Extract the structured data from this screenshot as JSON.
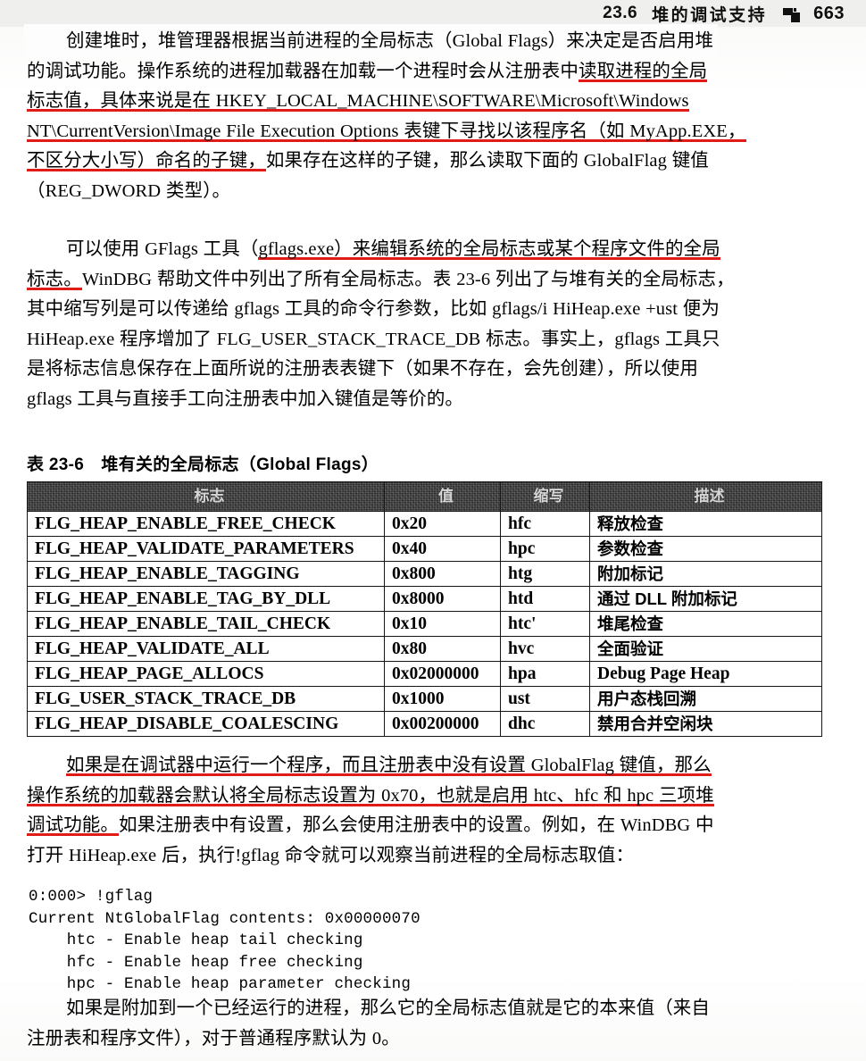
{
  "header": {
    "section_number": "23.6",
    "section_title": "堆的调试支持",
    "ornament": "black-block-ornament",
    "page_number": "663"
  },
  "paragraphs": {
    "p1": {
      "line1_highlighted": "创建堆时，堆管理器根据当前进程的全局标志（Global Flags）来决定是否启用堆",
      "line2_a": "的调试功能。操作系统的进程加载器在加载一个进程时会从注册表中",
      "line2_underlined": "读取进程的全局",
      "line3_underlined": "标志值，具体来说是在 HKEY_LOCAL_MACHINE\\SOFTWARE\\Microsoft\\Windows",
      "line4_underlined": "NT\\CurrentVersion\\Image File Execution Options 表键下寻找以该程序名（如 MyApp.EXE，",
      "line5_underlined": "不区分大小写）命名的子键，",
      "line5_rest": "如果存在这样的子键，那么读取下面的 GlobalFlag 键值",
      "line6": "（REG_DWORD 类型）。"
    },
    "p2": {
      "line1_a": "可以使用 GFlags 工具（",
      "line1_underlined": "gflags.exe）来编辑系统的全局标志或某个程序文件的全局",
      "line2_underlined": "标志。",
      "line2_rest": "WinDBG 帮助文件中列出了所有全局标志。表 23-6 列出了与堆有关的全局标志，",
      "line3": "其中缩写列是可以传递给 gflags 工具的命令行参数，比如 gflags/i HiHeap.exe +ust 便为",
      "line4": "HiHeap.exe 程序增加了 FLG_USER_STACK_TRACE_DB 标志。事实上，gflags 工具只",
      "line5": "是将标志信息保存在上面所说的注册表表键下（如果不存在，会先创建），所以使用",
      "line6": "gflags 工具与直接手工向注册表中加入键值是等价的。"
    },
    "p3": {
      "line1_underlined": "如果是在调试器中运行一个程序，而且注册表中没有设置 GlobalFlag 键值，那么",
      "line2_underlined": "操作系统的加载器会默认将全局标志设置为 0x70，也就是启用 htc、hfc 和 hpc 三项堆",
      "line3_underlined": "调试功能。",
      "line3_rest": "如果注册表中有设置，那么会使用注册表中的设置。例如，在 WinDBG 中",
      "line4": "打开 HiHeap.exe 后，执行!gflag 命令就可以观察当前进程的全局标志取值："
    },
    "p4": {
      "line1": "如果是附加到一个已经运行的进程，那么它的全局标志值就是它的本来值（来自",
      "line2": "注册表和程序文件），对于普通程序默认为 0。"
    }
  },
  "table": {
    "caption": "表 23-6　堆有关的全局标志（Global Flags）",
    "headers": [
      "标志",
      "值",
      "缩写",
      "描述"
    ],
    "rows": [
      [
        "FLG_HEAP_ENABLE_FREE_CHECK",
        "0x20",
        "hfc",
        "释放检查"
      ],
      [
        "FLG_HEAP_VALIDATE_PARAMETERS",
        "0x40",
        "hpc",
        "参数检查"
      ],
      [
        "FLG_HEAP_ENABLE_TAGGING",
        "0x800",
        "htg",
        "附加标记"
      ],
      [
        "FLG_HEAP_ENABLE_TAG_BY_DLL",
        "0x8000",
        "htd",
        "通过 DLL 附加标记"
      ],
      [
        "FLG_HEAP_ENABLE_TAIL_CHECK",
        "0x10",
        "htc'",
        "堆尾检查"
      ],
      [
        "FLG_HEAP_VALIDATE_ALL",
        "0x80",
        "hvc",
        "全面验证"
      ],
      [
        "FLG_HEAP_PAGE_ALLOCS",
        "0x02000000",
        "hpa",
        "Debug Page Heap"
      ],
      [
        "FLG_USER_STACK_TRACE_DB",
        "0x1000",
        "ust",
        "用户态栈回溯"
      ],
      [
        "FLG_HEAP_DISABLE_COALESCING",
        "0x00200000",
        "dhc",
        "禁用合并空闲块"
      ]
    ]
  },
  "code_block": "0:000> !gflag\nCurrent NtGlobalFlag contents: 0x00000070\n    htc - Enable heap tail checking\n    hfc - Enable heap free checking\n    hpc - Enable heap parameter checking",
  "colors": {
    "marker_red": "#e11b18",
    "ink": "#000000",
    "table_header_bg": "#2a2a2a",
    "running_head_bg": "#efefed"
  }
}
